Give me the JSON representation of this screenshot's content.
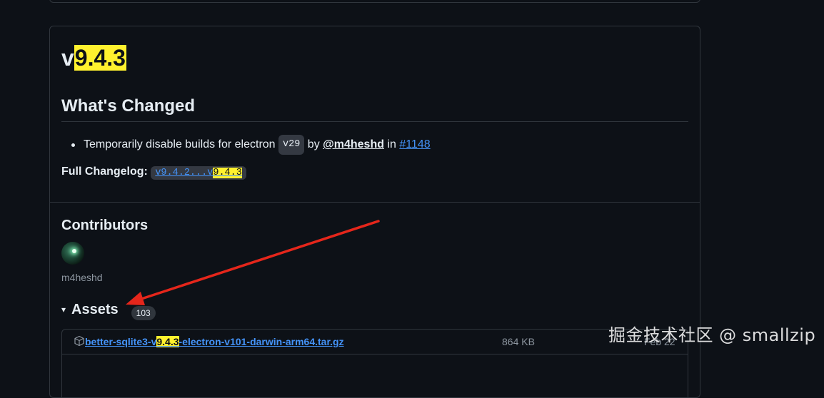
{
  "release": {
    "title_prefix": "v",
    "title_version": "9.4.3",
    "whats_changed_heading": "What's Changed",
    "change": {
      "text": "Temporarily disable builds for electron",
      "code": "v29",
      "by": "by",
      "author": "@m4heshd",
      "in": "in",
      "pr": "#1148"
    },
    "changelog": {
      "label": "Full Changelog:",
      "range_prefix": "v9.4.2...v",
      "range_version": "9.4.3"
    }
  },
  "contributors": {
    "heading": "Contributors",
    "name": "m4heshd"
  },
  "assets": {
    "heading": "Assets",
    "caret": "▾",
    "count": "103",
    "items": [
      {
        "name_prefix": "better-sqlite3-v",
        "name_version": "9.4.3",
        "name_suffix": "-electron-v101-darwin-arm64.tar.gz",
        "size": "864 KB",
        "date": "Feb 22"
      }
    ]
  },
  "watermark": "掘金技术社区 @ smallzip",
  "colors": {
    "background": "#0d1117",
    "highlight": "#fff12e",
    "link": "#4493f8",
    "annotation_arrow": "#e5261b"
  }
}
